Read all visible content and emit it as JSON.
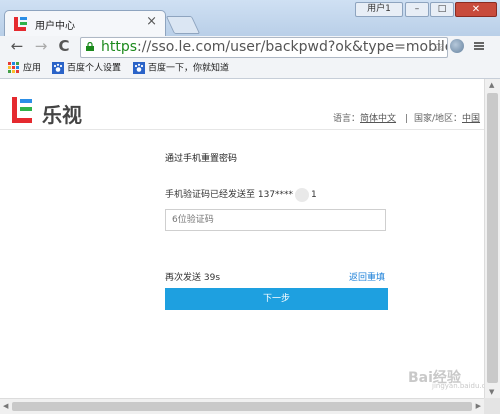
{
  "window": {
    "user_label": "用户1",
    "min_label": "–",
    "max_label": "□",
    "close_label": "✕"
  },
  "tab": {
    "title": "用户中心",
    "close": "×"
  },
  "toolbar": {
    "back": "←",
    "forward": "→",
    "reload": "C",
    "url_scheme": "https",
    "url_rest": "://sso.le.com/user/backpwd?ok&type=mobile&ne",
    "star": "☆"
  },
  "bookmarks": [
    {
      "label": "应用"
    },
    {
      "label": "百度个人设置"
    },
    {
      "label": "百度一下，你就知道"
    }
  ],
  "header": {
    "logo_text": "乐视",
    "language_label": "语言：",
    "language_value": "简体中文",
    "separator": "|",
    "region_label": "国家/地区：",
    "region_value": "中国"
  },
  "form": {
    "title": "通过手机重置密码",
    "sent_text": "手机验证码已经发送至 137****",
    "sent_suffix": "1",
    "code_placeholder": "6位验证码",
    "resend_text": "再次发送 39s",
    "refill_link": "返回重填",
    "next_button": "下一步"
  },
  "watermark": {
    "text": "Bai经验",
    "sub": "jingyan.baidu.com"
  },
  "colors": {
    "accent": "#1ea0e0",
    "link": "#1a7fd8",
    "brand_red": "#e52a2f",
    "https_green": "#1c8a1c"
  }
}
